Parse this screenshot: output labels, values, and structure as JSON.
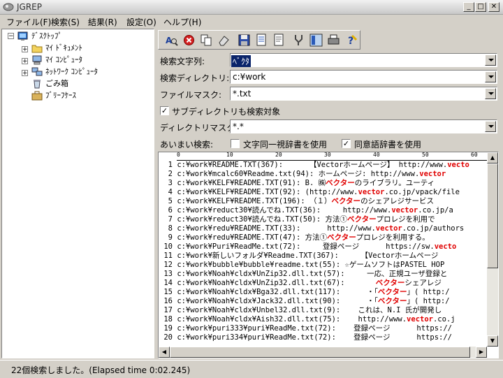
{
  "window": {
    "title": "JGREP"
  },
  "menu": [
    {
      "label": "ファイル(F)"
    },
    {
      "label": "検索(S)"
    },
    {
      "label": "結果(R)"
    },
    {
      "label": "設定(O)"
    },
    {
      "label": "ヘルプ(H)"
    }
  ],
  "tree": {
    "root": "ﾃﾞｽｸﾄｯﾌﾟ",
    "children": [
      "ﾏｲ ﾄﾞｷｭﾒﾝﾄ",
      "ﾏｲ ｺﾝﾋﾟｭｰﾀ",
      "ﾈｯﾄﾜｰｸ ｺﾝﾋﾟｭｰﾀ",
      "ごみ箱",
      "ﾌﾞﾘｰﾌｹｰｽ"
    ]
  },
  "toolbar": {
    "buttons": [
      "search-font-icon",
      "stop-icon",
      "copy-icon",
      "eraser-icon",
      "save-icon",
      "document-edit-icon",
      "document-icon",
      "tools-icon",
      "panel-icon",
      "printer-icon",
      "help-icon"
    ]
  },
  "form": {
    "search_label": "検索文字列:",
    "search_value": "ﾍﾞｸﾀ",
    "dir_label": "検索ディレクトリ:",
    "dir_value": "c:¥work",
    "mask_label": "ファイルマスク:",
    "mask_value": "*.txt",
    "subdir_label": "サブディレクトリも検索対象",
    "dirmask_label": "ディレクトリマスク:",
    "dirmask_value": "*.*",
    "fuzzy_label": "あいまい検索:",
    "char_dict_label": "文字同一視辞書を使用",
    "syn_dict_label": "同意語辞書を使用"
  },
  "ruler": [
    "0",
    "10",
    "20",
    "30",
    "40",
    "50",
    "60"
  ],
  "results": [
    {
      "n": "1",
      "pre": "c:¥work¥README.TXT(367):      【Vectorホームページ】 http://www.",
      "hl": "vecto",
      "post": ""
    },
    {
      "n": "2",
      "pre": "c:¥work¥mcalc60¥Readme.txt(94): ホームページ: http://www.",
      "hl": "vector",
      "post": ""
    },
    {
      "n": "3",
      "pre": "c:¥work¥KELF¥README.TXT(91): B. ㈱",
      "hl": "ベクター",
      "post": "のライブラリ。ユーティ"
    },
    {
      "n": "4",
      "pre": "c:¥work¥KELF¥README.TXT(92): (http://www.",
      "hl": "vector",
      "post": ".co.jp/vpack/file"
    },
    {
      "n": "5",
      "pre": "c:¥work¥KELF¥README.TXT(196): （１）",
      "hl": "ベクター",
      "post": "のシェアレジサービス"
    },
    {
      "n": "6",
      "pre": "c:¥work¥reduct30¥読んでね.TXT(36):     http://www.",
      "hl": "vector",
      "post": ".co.jp/a"
    },
    {
      "n": "7",
      "pre": "c:¥work¥reduct30¥読んでね.TXT(50): 方法①",
      "hl": "ベクター",
      "post": "プロレジを利用で"
    },
    {
      "n": "8",
      "pre": "c:¥work¥redu¥README.TXT(33):      http://www.",
      "hl": "vector",
      "post": ".co.jp/authors"
    },
    {
      "n": "9",
      "pre": "c:¥work¥redu¥README.TXT(47): 方法①",
      "hl": "ベクター",
      "post": "プロレジを利用する。"
    },
    {
      "n": "10",
      "pre": "c:¥work¥Puri¥ReadMe.txt(72):     登録ページ      https://sw.",
      "hl": "vecto",
      "post": ""
    },
    {
      "n": "11",
      "pre": "c:¥work¥新しいフォルダ¥Readme.TXT(367):     【Vectorホームページ",
      "hl": "",
      "post": ""
    },
    {
      "n": "12",
      "pre": "c:¥work¥bubble¥bubble¥readme.txt(55): ☆ゲームソフトはPASTEL HOP",
      "hl": "",
      "post": ""
    },
    {
      "n": "13",
      "pre": "c:¥work¥Noah¥cldx¥UnZip32.dll.txt(57):     一応、正規ユーザ登録と",
      "hl": "",
      "post": ""
    },
    {
      "n": "14",
      "pre": "c:¥work¥Noah¥cldx¥UnZip32.dll.txt(67):       ",
      "hl": "ベクター",
      "post": "シェアレジ"
    },
    {
      "n": "15",
      "pre": "c:¥work¥Noah¥cldx¥Bga32.dll.txt(117):      ・「",
      "hl": "ベクター",
      "post": "」( http:/"
    },
    {
      "n": "16",
      "pre": "c:¥work¥Noah¥cldx¥Jack32.dll.txt(90):      ・「",
      "hl": "ベクター",
      "post": "」( http:/"
    },
    {
      "n": "17",
      "pre": "c:¥work¥Noah¥cldx¥Unbel32.dll.txt(9):    これは、N.I 氏が開発し",
      "hl": "",
      "post": ""
    },
    {
      "n": "18",
      "pre": "c:¥work¥Noah¥cldx¥Aish32.dll.txt(75):    http://www.",
      "hl": "vector",
      "post": ".co.j"
    },
    {
      "n": "19",
      "pre": "c:¥work¥puri333¥puri¥ReadMe.txt(72):    登録ページ      https://",
      "hl": "",
      "post": ""
    },
    {
      "n": "20",
      "pre": "c:¥work¥puri334¥puri¥ReadMe.txt(72):    登録ページ      https://",
      "hl": "",
      "post": ""
    }
  ],
  "status": "22個検索しました。(Elapsed time 0:02.245)"
}
